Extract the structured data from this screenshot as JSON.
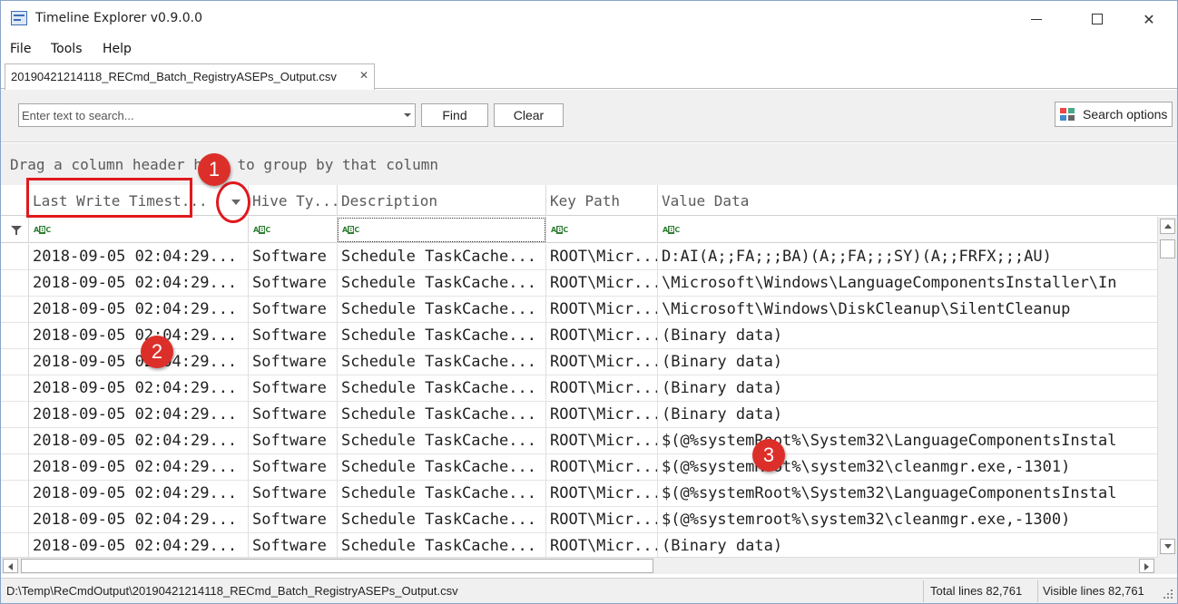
{
  "window": {
    "title": "Timeline Explorer v0.9.0.0",
    "controls": {
      "minimize": "",
      "maximize": "",
      "close": "✕"
    }
  },
  "menu": [
    "File",
    "Tools",
    "Help"
  ],
  "tab": {
    "label": "20190421214118_RECmd_Batch_RegistryASEPs_Output.csv",
    "close": "✕"
  },
  "search": {
    "placeholder": "Enter text to search...",
    "find_label": "Find",
    "clear_label": "Clear",
    "options_label": "Search options"
  },
  "grid": {
    "group_hint": "Drag a column header here to group by that column",
    "columns": [
      "Last Write Timest...",
      "Hive Ty...",
      "Description",
      "Key Path",
      "Value Data"
    ],
    "rows": [
      [
        "2018-09-05 02:04:29...",
        "Software",
        "Schedule TaskCache...",
        "ROOT\\Micr...",
        "D:AI(A;;FA;;;BA)(A;;FA;;;SY)(A;;FRFX;;;AU)"
      ],
      [
        "2018-09-05 02:04:29...",
        "Software",
        "Schedule TaskCache...",
        "ROOT\\Micr...",
        "\\Microsoft\\Windows\\LanguageComponentsInstaller\\In"
      ],
      [
        "2018-09-05 02:04:29...",
        "Software",
        "Schedule TaskCache...",
        "ROOT\\Micr...",
        "\\Microsoft\\Windows\\DiskCleanup\\SilentCleanup"
      ],
      [
        "2018-09-05 02:04:29...",
        "Software",
        "Schedule TaskCache...",
        "ROOT\\Micr...",
        "(Binary data)"
      ],
      [
        "2018-09-05 02:04:29...",
        "Software",
        "Schedule TaskCache...",
        "ROOT\\Micr...",
        "(Binary data)"
      ],
      [
        "2018-09-05 02:04:29...",
        "Software",
        "Schedule TaskCache...",
        "ROOT\\Micr...",
        "(Binary data)"
      ],
      [
        "2018-09-05 02:04:29...",
        "Software",
        "Schedule TaskCache...",
        "ROOT\\Micr...",
        "(Binary data)"
      ],
      [
        "2018-09-05 02:04:29...",
        "Software",
        "Schedule TaskCache...",
        "ROOT\\Micr...",
        "$(@%systemRoot%\\System32\\LanguageComponentsInstal"
      ],
      [
        "2018-09-05 02:04:29...",
        "Software",
        "Schedule TaskCache...",
        "ROOT\\Micr...",
        "$(@%systemRoot%\\system32\\cleanmgr.exe,-1301)"
      ],
      [
        "2018-09-05 02:04:29...",
        "Software",
        "Schedule TaskCache...",
        "ROOT\\Micr...",
        "$(@%systemRoot%\\System32\\LanguageComponentsInstal"
      ],
      [
        "2018-09-05 02:04:29...",
        "Software",
        "Schedule TaskCache...",
        "ROOT\\Micr...",
        "$(@%systemroot%\\system32\\cleanmgr.exe,-1300)"
      ],
      [
        "2018-09-05 02:04:29...",
        "Software",
        "Schedule TaskCache...",
        "ROOT\\Micr...",
        "(Binary data)"
      ]
    ]
  },
  "status": {
    "path": "D:\\Temp\\ReCmdOutput\\20190421214118_RECmd_Batch_RegistryASEPs_Output.csv",
    "total": "Total lines 82,761",
    "visible": "Visible lines 82,761"
  },
  "annotations": {
    "badge1": "1",
    "badge2": "2",
    "badge3": "3"
  },
  "colors": {
    "annotation": "#e0191e",
    "badge": "#dc2f2a",
    "filter_icon": "#2e7d32"
  }
}
